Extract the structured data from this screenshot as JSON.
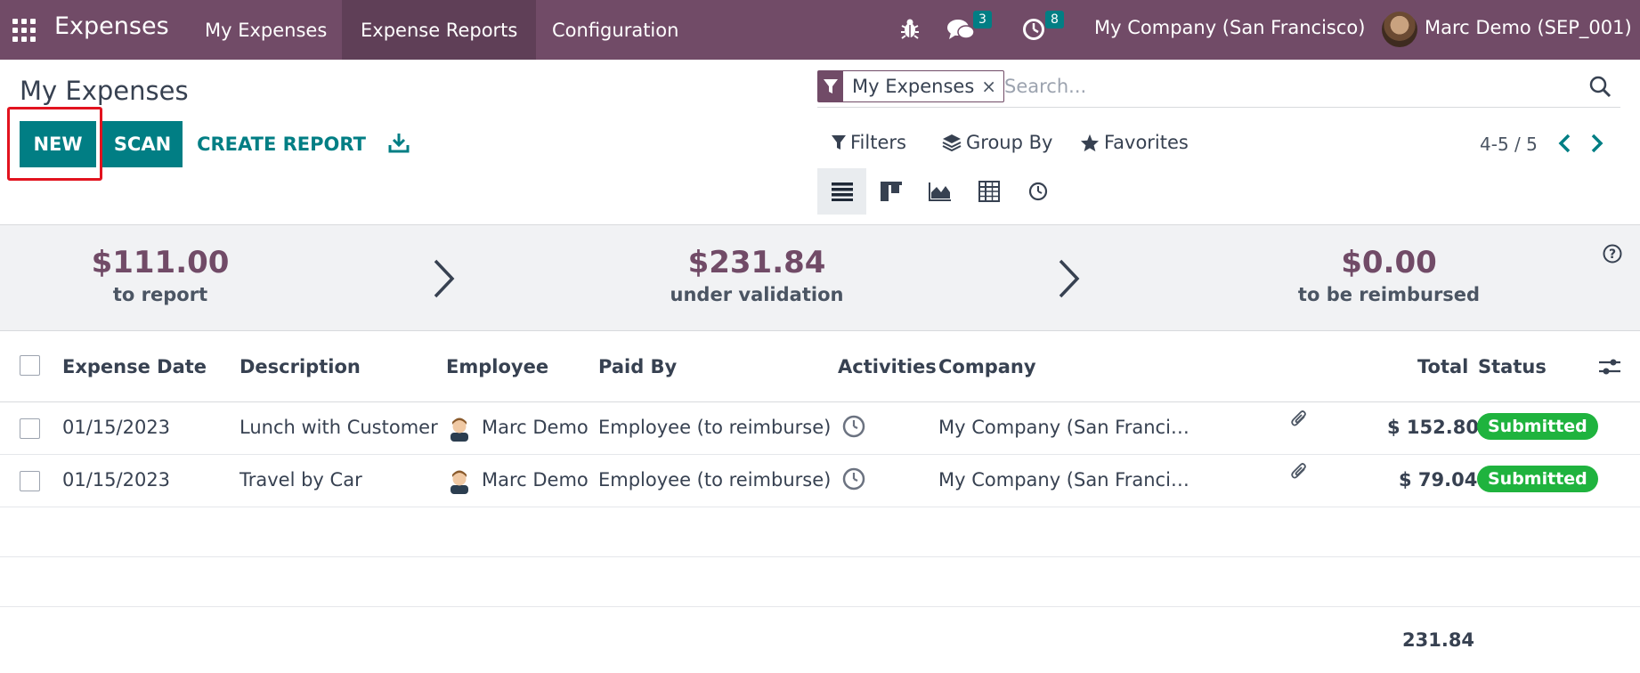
{
  "topbar": {
    "app_name": "Expenses",
    "menus": [
      "My Expenses",
      "Expense Reports",
      "Configuration"
    ],
    "messages_count": "3",
    "activities_count": "8",
    "company": "My Company (San Francisco)",
    "user": "Marc Demo (SEP_001)",
    "bg_color": "#714B67"
  },
  "control_panel": {
    "title": "My Expenses",
    "buttons": {
      "new": "NEW",
      "scan": "SCAN",
      "create_report": "CREATE REPORT"
    },
    "search": {
      "facet": "My Expenses",
      "placeholder": "Search..."
    },
    "filters": "Filters",
    "group_by": "Group By",
    "favorites": "Favorites",
    "pager": "4-5 / 5",
    "views": [
      "list-view-icon",
      "kanban-view-icon",
      "graph-view-icon",
      "pivot-view-icon",
      "activity-view-icon"
    ]
  },
  "summary": {
    "to_report": {
      "amount": "$111.00",
      "label": "to report"
    },
    "under_validation": {
      "amount": "$231.84",
      "label": "under validation"
    },
    "to_be_reimbursed": {
      "amount": "$0.00",
      "label": "to be reimbursed"
    }
  },
  "table": {
    "headers": {
      "expense_date": "Expense Date",
      "description": "Description",
      "employee": "Employee",
      "paid_by": "Paid By",
      "activities": "Activities",
      "company": "Company",
      "total": "Total",
      "status": "Status"
    },
    "rows": [
      {
        "date": "01/15/2023",
        "description": "Lunch with Customer",
        "employee": "Marc Demo",
        "paid_by": "Employee (to reimburse)",
        "company": "My Company (San Franci…",
        "total": "$ 152.80",
        "status": "Submitted"
      },
      {
        "date": "01/15/2023",
        "description": "Travel by Car",
        "employee": "Marc Demo",
        "paid_by": "Employee (to reimburse)",
        "company": "My Company (San Franci…",
        "total": "$ 79.04",
        "status": "Submitted"
      }
    ],
    "grand_total": "231.84"
  },
  "colors": {
    "primary": "#017e84",
    "brand": "#714B67",
    "status_submitted": "#1fb33e",
    "highlight": "#e2131f"
  }
}
